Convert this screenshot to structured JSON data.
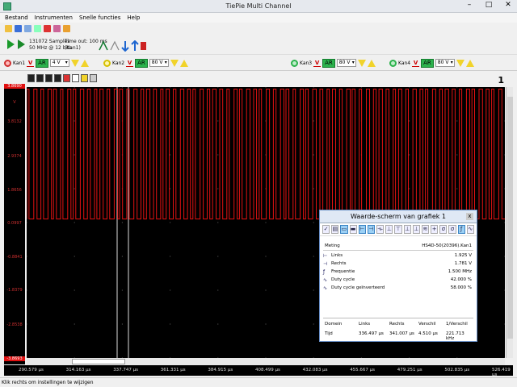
{
  "window": {
    "title": "TiePie Multi Channel"
  },
  "menu": [
    "Bestand",
    "Instrumenten",
    "Snelle functies",
    "Help"
  ],
  "acq": {
    "samples": "131072 Samples",
    "rate": "50 MHz @ 12 bits",
    "timeout": "Time out: 100 ms",
    "source": "(Kan1)"
  },
  "channels": [
    {
      "label": "Kan1",
      "range": "4 V",
      "color": "#d03030"
    },
    {
      "label": "Kan2",
      "range": "80 V",
      "color": "#e8d000"
    },
    {
      "label": "Kan3",
      "range": "80 V",
      "color": "#2bb24c"
    },
    {
      "label": "Kan4",
      "range": "80 V",
      "color": "#2bb24c"
    }
  ],
  "ar_label": "AR",
  "close_one": "1",
  "yaxis": [
    "3.8690",
    "V",
    "3.8132",
    "2.9374",
    "1.8656",
    "0.0997",
    "-0.8841",
    "-1.8379",
    "-2.8538",
    "-3.8693"
  ],
  "xaxis": [
    "290.579 µs",
    "314.163 µs",
    "337.747 µs",
    "361.331 µs",
    "384.915 µs",
    "408.499 µs",
    "432.083 µs",
    "455.667 µs",
    "479.251 µs",
    "502.835 µs",
    "526.419 µs"
  ],
  "status": "Klik rechts om instellingen te wijzigen",
  "dialog": {
    "title": "Waarde-scherm van grafiek 1",
    "close": "x",
    "meting_label": "Meting",
    "meting_source": "HS4D-50(20396).Kan1",
    "rows": [
      {
        "icon": "cursor-left-icon",
        "label": "Links",
        "value": "1.925 V"
      },
      {
        "icon": "cursor-right-icon",
        "label": "Rechts",
        "value": "1.781 V"
      },
      {
        "icon": "frequency-icon",
        "label": "Frequentie",
        "value": "1.500 MHz"
      },
      {
        "icon": "duty-cycle-icon",
        "label": "Duty cycle",
        "value": "42.000 %"
      },
      {
        "icon": "duty-cycle-inv-icon",
        "label": "Duty cycle geïnverteerd",
        "value": "58.000 %"
      }
    ],
    "domain": {
      "headers": [
        "Domein",
        "Links",
        "Rechts",
        "Verschil",
        "1/Verschil"
      ],
      "values": [
        "Tijd",
        "336.497 µs",
        "341.007 µs",
        "4.510 µs",
        "221.713 kHz"
      ]
    }
  },
  "trace": {
    "color": "#e21212",
    "high_level": 3.81,
    "low_level": 0.1,
    "duty_cycle": 0.42,
    "periods": 72
  }
}
